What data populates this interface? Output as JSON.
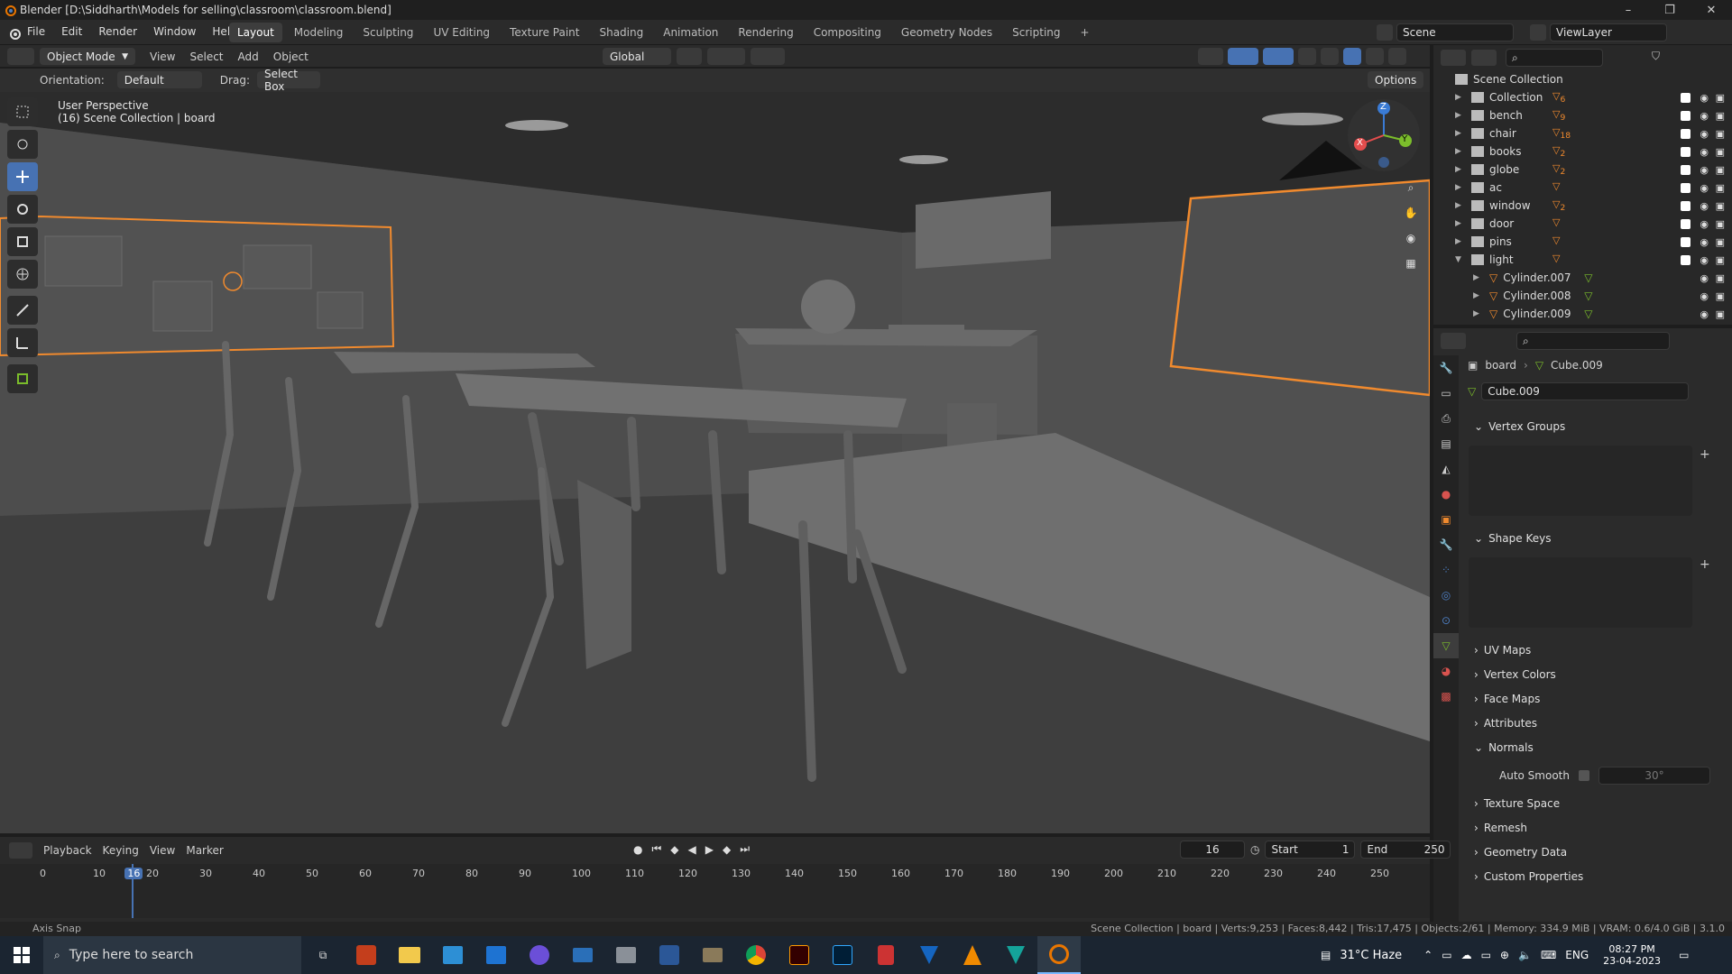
{
  "window": {
    "title": "Blender [D:\\Siddharth\\Models for selling\\classroom\\classroom.blend]",
    "minimize": "–",
    "maximize": "❐",
    "close": "✕"
  },
  "menu": [
    "File",
    "Edit",
    "Render",
    "Window",
    "Help"
  ],
  "workspaces": [
    "Layout",
    "Modeling",
    "Sculpting",
    "UV Editing",
    "Texture Paint",
    "Shading",
    "Animation",
    "Rendering",
    "Compositing",
    "Geometry Nodes",
    "Scripting",
    "+"
  ],
  "active_workspace": "Layout",
  "scene": "Scene",
  "view_layer": "ViewLayer",
  "viewport_header": {
    "mode": "Object Mode",
    "menus": [
      "View",
      "Select",
      "Add",
      "Object"
    ],
    "transform": "Global",
    "orientation_label": "Orientation:",
    "orientation_value": "Default",
    "drag_label": "Drag:",
    "drag_value": "Select Box",
    "options": "Options"
  },
  "viewport_overlay": {
    "perspective": "User Perspective",
    "collection": "(16) Scene Collection | board"
  },
  "gizmo": {
    "x": "X",
    "y": "Y",
    "z": "Z"
  },
  "outliner": {
    "root": "Scene Collection",
    "items": [
      {
        "name": "Collection",
        "count": "6"
      },
      {
        "name": "bench",
        "count": "9"
      },
      {
        "name": "chair",
        "count": "18"
      },
      {
        "name": "books",
        "count": "2"
      },
      {
        "name": "globe",
        "count": "2"
      },
      {
        "name": "ac",
        "count": ""
      },
      {
        "name": "window",
        "count": "2"
      },
      {
        "name": "door",
        "count": ""
      },
      {
        "name": "pins",
        "count": ""
      },
      {
        "name": "light",
        "count": ""
      }
    ],
    "children": [
      "Cylinder.007",
      "Cylinder.008",
      "Cylinder.009"
    ]
  },
  "properties": {
    "breadcrumb_object": "board",
    "breadcrumb_mesh": "Cube.009",
    "mesh_name": "Cube.009",
    "panels": {
      "vertex_groups": "Vertex Groups",
      "shape_keys": "Shape Keys",
      "uv_maps": "UV Maps",
      "vertex_colors": "Vertex Colors",
      "face_maps": "Face Maps",
      "attributes": "Attributes",
      "normals": "Normals",
      "auto_smooth": "Auto Smooth",
      "auto_smooth_angle": "30°",
      "texture_space": "Texture Space",
      "remesh": "Remesh",
      "geometry_data": "Geometry Data",
      "custom_properties": "Custom Properties"
    }
  },
  "timeline": {
    "menus": [
      "Playback",
      "Keying",
      "View",
      "Marker"
    ],
    "current_frame": "16",
    "start_label": "Start",
    "start": "1",
    "end_label": "End",
    "end": "250",
    "ticks": [
      "0",
      "10",
      "16",
      "20",
      "30",
      "40",
      "50",
      "60",
      "70",
      "80",
      "90",
      "100",
      "110",
      "120",
      "130",
      "140",
      "150",
      "160",
      "170",
      "180",
      "190",
      "200",
      "210",
      "220",
      "230",
      "240",
      "250"
    ]
  },
  "status": {
    "left": "Axis Snap",
    "right": "Scene Collection | board | Verts:9,253 | Faces:8,442 | Tris:17,475 | Objects:2/61 | Memory: 334.9 MiB | VRAM: 0.6/4.0 GiB | 3.1.0"
  },
  "taskbar": {
    "search_placeholder": "Type here to search",
    "weather": "31°C  Haze",
    "lang": "ENG",
    "time": "08:27 PM",
    "date": "23-04-2023"
  },
  "colors": {
    "accent": "#4772b3",
    "selection_orange": "#f08a2e",
    "viewport_bg": "#3c3c3c"
  }
}
